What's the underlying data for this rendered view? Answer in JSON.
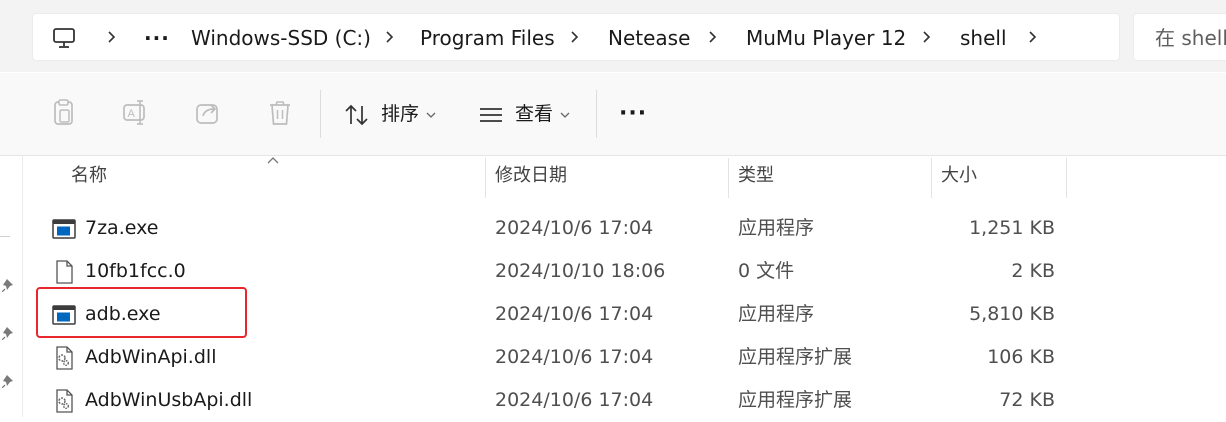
{
  "breadcrumb": {
    "overflow": "···",
    "segments": [
      "Windows-SSD (C:)",
      "Program Files",
      "Netease",
      "MuMu Player 12",
      "shell"
    ]
  },
  "search": {
    "placeholder": "在 shell"
  },
  "toolbar": {
    "sort_label": "排序",
    "view_label": "查看",
    "more_label": "···"
  },
  "columns": {
    "name": "名称",
    "date": "修改日期",
    "type": "类型",
    "size": "大小"
  },
  "files": [
    {
      "name": "7za.exe",
      "date": "2024/10/6 17:04",
      "type": "应用程序",
      "size": "1,251 KB",
      "icon": "exe-icon"
    },
    {
      "name": "10fb1fcc.0",
      "date": "2024/10/10 18:06",
      "type": "0 文件",
      "size": "2 KB",
      "icon": "blank-file-icon"
    },
    {
      "name": "adb.exe",
      "date": "2024/10/6 17:04",
      "type": "应用程序",
      "size": "5,810 KB",
      "icon": "exe-icon"
    },
    {
      "name": "AdbWinApi.dll",
      "date": "2024/10/6 17:04",
      "type": "应用程序扩展",
      "size": "106 KB",
      "icon": "dll-icon"
    },
    {
      "name": "AdbWinUsbApi.dll",
      "date": "2024/10/6 17:04",
      "type": "应用程序扩展",
      "size": "72 KB",
      "icon": "dll-icon"
    }
  ],
  "colors": {
    "accent": "#0067c0",
    "highlight": "#e8262b"
  }
}
